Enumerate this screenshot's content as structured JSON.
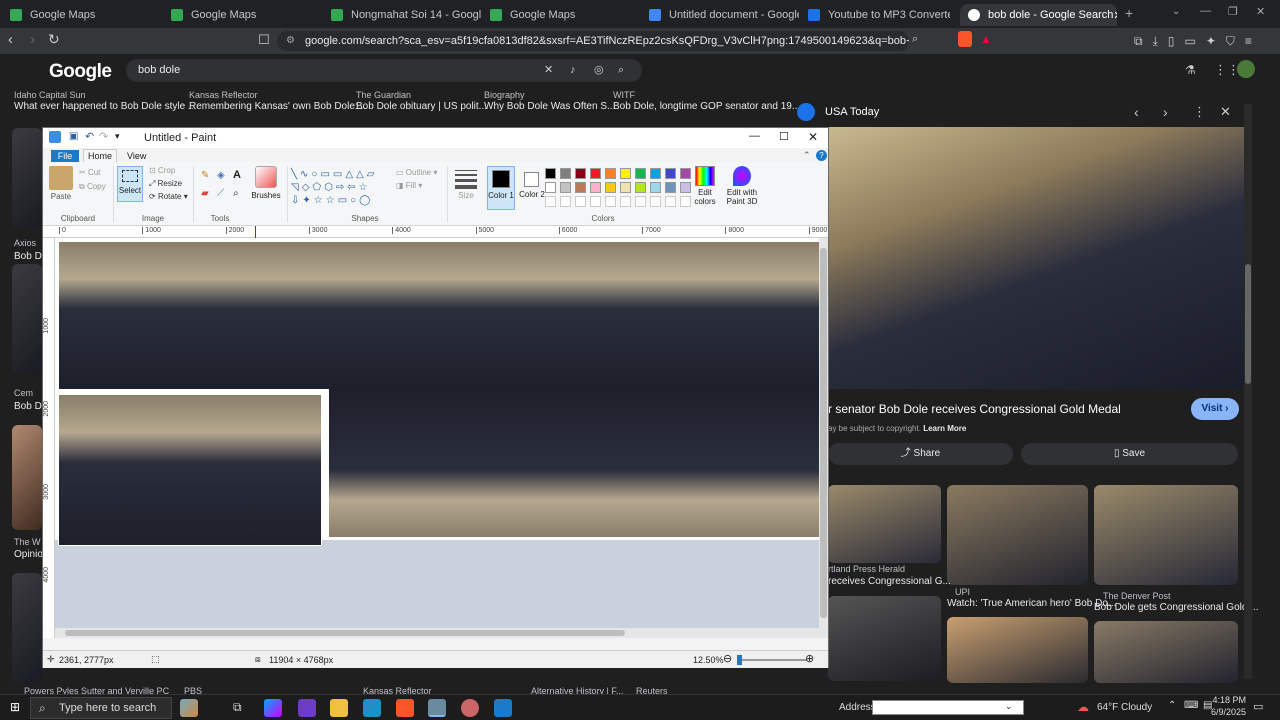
{
  "browser": {
    "tabs": [
      {
        "label": "Google Maps",
        "color": "#34a853",
        "active": false
      },
      {
        "label": "Google Maps",
        "color": "#34a853",
        "active": false
      },
      {
        "label": "Nongmahat Soi 14 - Google Maps",
        "color": "#34a853",
        "active": false
      },
      {
        "label": "Google Maps",
        "color": "#34a853",
        "active": false
      },
      {
        "label": "Untitled document - Google Docs",
        "color": "#4285f4",
        "active": false
      },
      {
        "label": "Youtube to MP3 Converter | Fast, Fr",
        "color": "#1a73e8",
        "active": false
      },
      {
        "label": "bob dole - Google Search",
        "color": "#ffffff",
        "active": true
      }
    ],
    "url": "google.com/search?sca_esv=a5f19cfa0813df82&sxsrf=AE3TifNczREpz2csKsQFDrg_V3vClH7png:1749500149623&q=bob+dole&udm=2&fbs=A..."
  },
  "google": {
    "logo": "Google",
    "query": "bob dole",
    "top_results": [
      {
        "source": "Idaho Capital Sun",
        "title": "What ever happened to Bob Dole style ..."
      },
      {
        "source": "Kansas Reflector",
        "title": "Remembering Kansas' own Bob Dole:..."
      },
      {
        "source": "The Guardian",
        "title": "Bob Dole obituary | US polit..."
      },
      {
        "source": "Biography",
        "title": "Why Bob Dole Was Often S..."
      },
      {
        "source": "WITF",
        "title": "Bob Dole, longtime GOP senator and 19..."
      }
    ],
    "left_snippets": [
      "Axios",
      "Bob Do",
      "Cem",
      "Bob Do",
      "The W",
      "Opinio"
    ],
    "bottom_sources": [
      "Powers Pyles Sutter and Verville PC",
      "PBS",
      "Kansas Reflector",
      "Alternative History | F...",
      "Reuters"
    ],
    "preview": {
      "source": "USA Today",
      "title": "r senator Bob Dole receives Congressional Gold Medal",
      "copyright": "ay be subject to copyright.",
      "learn_more": "Learn More",
      "visit": "Visit",
      "share": "Share",
      "save": "Save"
    },
    "related": [
      {
        "source": "rtland Press Herald",
        "title": "receives Congressional G..."
      },
      {
        "source": "UPI",
        "title": "Watch: 'True American hero' Bob Do..."
      },
      {
        "source": "The Denver Post",
        "title": "Bob Dole gets Congressional Gold ..."
      }
    ]
  },
  "paint": {
    "title": "Untitled - Paint",
    "tabs": {
      "file": "File",
      "home": "Home",
      "view": "View"
    },
    "clipboard": {
      "paste": "Paste",
      "cut": "Cut",
      "copy": "Copy",
      "group": "Clipboard"
    },
    "image": {
      "select": "Select",
      "crop": "Crop",
      "resize": "Resize",
      "rotate": "Rotate",
      "group": "Image"
    },
    "tools_group": "Tools",
    "brushes": "Brushes",
    "shapes": {
      "outline": "Outline",
      "fill": "Fill",
      "group": "Shapes"
    },
    "size": "Size",
    "color1": "Color 1",
    "color2": "Color 2",
    "edit_colors": "Edit colors",
    "edit_paint3d": "Edit with Paint 3D",
    "colors_group": "Colors",
    "palette": [
      "#000000",
      "#7f7f7f",
      "#880015",
      "#ed1c24",
      "#ff7f27",
      "#fff200",
      "#22b14c",
      "#00a2e8",
      "#3f48cc",
      "#a349a4",
      "#ffffff",
      "#c3c3c3",
      "#b97a57",
      "#ffaec9",
      "#ffc90e",
      "#efe4b0",
      "#b5e61d",
      "#99d9ea",
      "#7092be",
      "#c8bfe7"
    ],
    "ruler_marks": [
      "0",
      "1000",
      "2000",
      "3000",
      "4000",
      "5000",
      "6000",
      "7000",
      "8000",
      "9000"
    ],
    "vruler_marks": [
      "1000",
      "2000",
      "3000",
      "4000"
    ],
    "status": {
      "cursor": "2361, 2777px",
      "size": "11904 × 4768px",
      "zoom": "12.50%"
    }
  },
  "taskbar": {
    "search": "Type here to search",
    "address_label": "Address",
    "weather": "64°F Cloudy",
    "time": "4:18 PM",
    "date": "6/9/2025"
  }
}
